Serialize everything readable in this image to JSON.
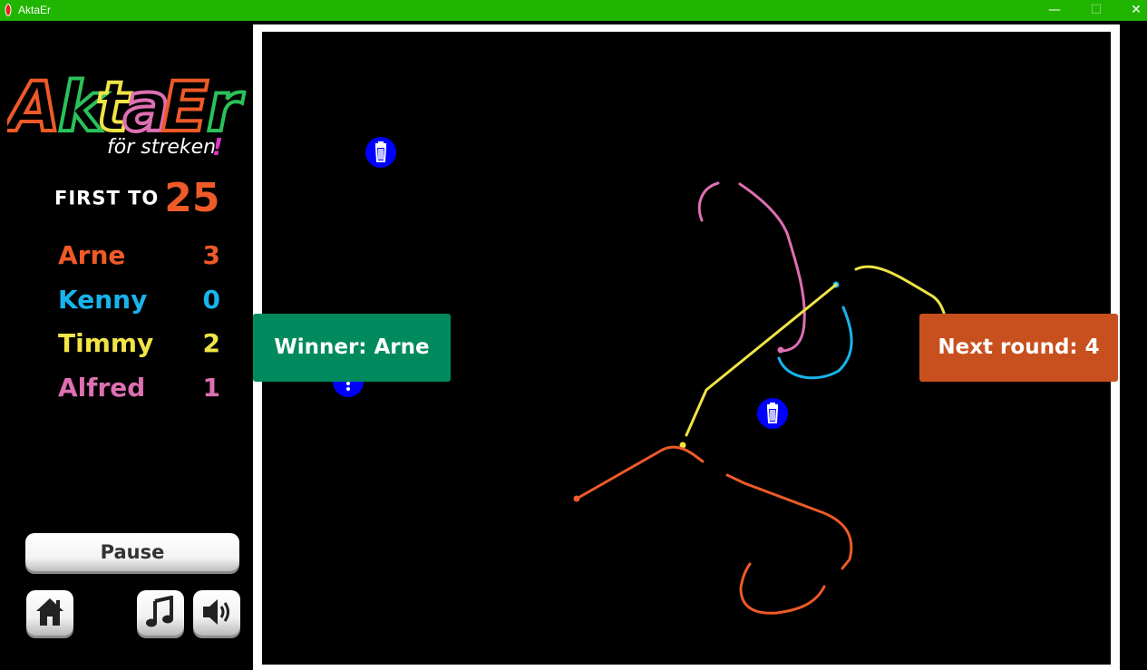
{
  "window": {
    "title": "AktaEr",
    "minimize_glyph": "—",
    "maximize_glyph": "☐",
    "close_glyph": "✕"
  },
  "logo": {
    "title": "AktaEr",
    "subtitle": "för streken",
    "exclaim": "!"
  },
  "first_to": {
    "label": "FIRST TO",
    "value": "25",
    "color": "#ee5a28"
  },
  "players": [
    {
      "name": "Arne",
      "score": "3",
      "color": "#ee5a28"
    },
    {
      "name": "Kenny",
      "score": "0",
      "color": "#18b4ec"
    },
    {
      "name": "Timmy",
      "score": "2",
      "color": "#f0e446"
    },
    {
      "name": "Alfred",
      "score": "1",
      "color": "#dd6fb2"
    }
  ],
  "controls": {
    "pause_label": "Pause",
    "home_icon": "home-icon",
    "music_icon": "music-note-icon",
    "sound_icon": "speaker-icon"
  },
  "overlay": {
    "winner_text": "Winner: Arne",
    "next_round_text": "Next round: 4",
    "winner_color": "#008a5e",
    "next_round_color": "#c8501e"
  },
  "powerups": [
    {
      "icon": "trash-icon"
    },
    {
      "icon": "trash-icon"
    },
    {
      "icon": "more-vertical-icon"
    }
  ]
}
